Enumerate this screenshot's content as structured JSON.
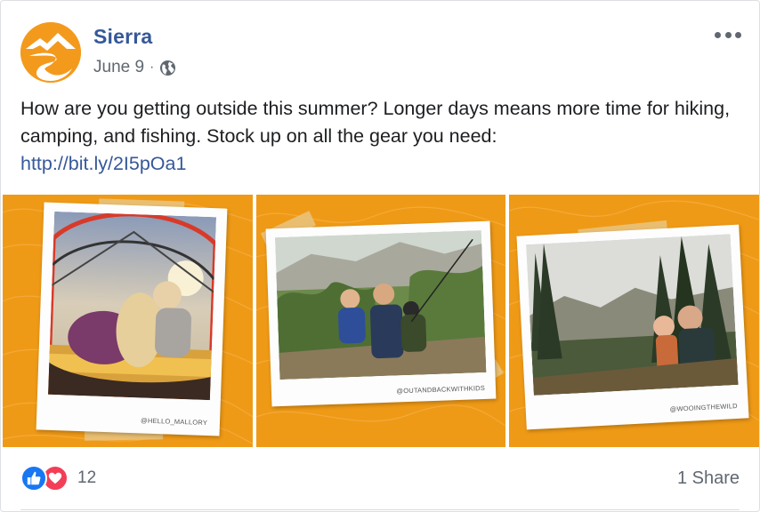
{
  "post": {
    "page_name": "Sierra",
    "date": "June 9",
    "separator": "·",
    "privacy_icon": "globe-icon",
    "text_line": "How are you getting outside this summer? Longer days means more time for hiking, camping, and fishing. Stock up on all the gear you need:",
    "link": "http://bit.ly/2I5pOa1"
  },
  "images": [
    {
      "credit": "@HELLO_MALLORY",
      "alt_icon": "camping-tent-photo"
    },
    {
      "credit": "@OUTANDBACKWITHKIDS",
      "alt_icon": "fishing-family-photo"
    },
    {
      "credit": "@WOOINGTHEWILD",
      "alt_icon": "forest-selfie-photo"
    }
  ],
  "footer": {
    "reaction_count": "12",
    "shares": "1 Share"
  },
  "colors": {
    "brand_orange": "#ef9a16",
    "link_blue": "#365899",
    "like_blue": "#1877f2",
    "love_red": "#f33e58"
  }
}
